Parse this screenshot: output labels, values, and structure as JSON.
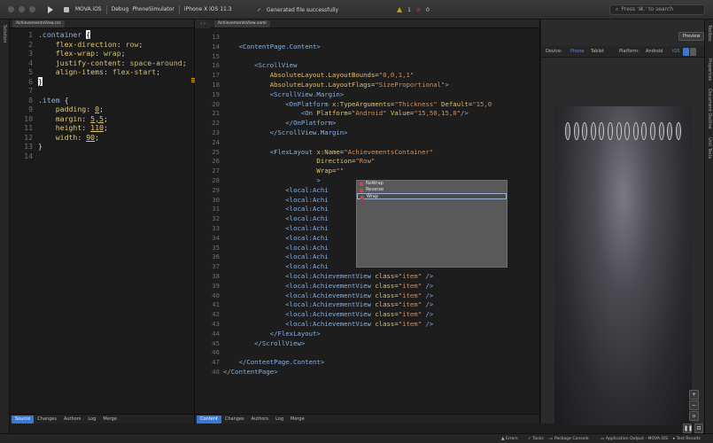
{
  "titlebar": {
    "project": "MOVA.iOS",
    "config": "Debug",
    "target": "PhoneSimulator",
    "device": "iPhone X iOS 11.3",
    "status": "Generated file successfully",
    "warnings": "1",
    "errors": "0",
    "search_placeholder": "Press '⌘.' to search"
  },
  "left_strip": {
    "label": "Solution"
  },
  "css_editor": {
    "tab": "AchievementsView.css",
    "lines": [
      {
        "n": "1",
        "parts": [
          [
            ".container ",
            "sel"
          ],
          [
            "{",
            "cur"
          ]
        ]
      },
      {
        "n": "2",
        "parts": [
          [
            "    flex-direction",
            "prop"
          ],
          [
            ": ",
            "pun"
          ],
          [
            "row",
            "val"
          ],
          [
            ";",
            "pun"
          ]
        ]
      },
      {
        "n": "3",
        "parts": [
          [
            "    flex-wrap",
            "prop"
          ],
          [
            ": ",
            "pun"
          ],
          [
            "wrap",
            "val"
          ],
          [
            ";",
            "pun"
          ]
        ]
      },
      {
        "n": "4",
        "parts": [
          [
            "    justify-content",
            "prop"
          ],
          [
            ": ",
            "pun"
          ],
          [
            "space-around",
            "val"
          ],
          [
            ";",
            "pun"
          ]
        ]
      },
      {
        "n": "5",
        "parts": [
          [
            "    align-items",
            "prop"
          ],
          [
            ": ",
            "pun"
          ],
          [
            "flex-start",
            "val"
          ],
          [
            ";",
            "pun"
          ]
        ]
      },
      {
        "n": "6",
        "parts": [
          [
            "}",
            "cur"
          ]
        ]
      },
      {
        "n": "7",
        "parts": []
      },
      {
        "n": "8",
        "parts": [
          [
            ".item ",
            "sel"
          ],
          [
            "{",
            "pun"
          ]
        ]
      },
      {
        "n": "9",
        "parts": [
          [
            "    padding",
            "prop"
          ],
          [
            ": ",
            "pun"
          ],
          [
            "0",
            "num"
          ],
          [
            ";",
            "pun"
          ]
        ]
      },
      {
        "n": "10",
        "parts": [
          [
            "    margin",
            "prop"
          ],
          [
            ": ",
            "pun"
          ],
          [
            "5,5",
            "num"
          ],
          [
            ";",
            "pun"
          ]
        ]
      },
      {
        "n": "11",
        "parts": [
          [
            "    height",
            "prop"
          ],
          [
            ": ",
            "pun"
          ],
          [
            "110",
            "num"
          ],
          [
            ";",
            "pun"
          ]
        ]
      },
      {
        "n": "12",
        "parts": [
          [
            "    width",
            "prop"
          ],
          [
            ": ",
            "pun"
          ],
          [
            "90",
            "num"
          ],
          [
            ";",
            "pun"
          ]
        ]
      },
      {
        "n": "13",
        "parts": [
          [
            "}",
            "pun"
          ]
        ]
      },
      {
        "n": "14",
        "parts": []
      }
    ],
    "bottom_tabs": [
      "Source",
      "Changes",
      "Authors",
      "Log",
      "Merge"
    ]
  },
  "xaml_editor": {
    "tab": "AchievementsView.xaml",
    "lines": [
      {
        "n": "13",
        "parts": []
      },
      {
        "n": "14",
        "parts": [
          [
            "    <ContentPage.Content>",
            "tag"
          ]
        ]
      },
      {
        "n": "15",
        "parts": []
      },
      {
        "n": "16",
        "parts": [
          [
            "        <ScrollView",
            "tag"
          ]
        ]
      },
      {
        "n": "17",
        "parts": [
          [
            "            AbsoluteLayout.LayoutBounds",
            "attr"
          ],
          [
            "=",
            "txt"
          ],
          [
            "\"0,0,1,1\"",
            "str"
          ]
        ]
      },
      {
        "n": "18",
        "parts": [
          [
            "            AbsoluteLayout.LayoutFlags",
            "attr"
          ],
          [
            "=",
            "txt"
          ],
          [
            "\"SizeProportional\"",
            "str"
          ],
          [
            ">",
            "tag"
          ]
        ]
      },
      {
        "n": "19",
        "parts": [
          [
            "            <ScrollView.Margin>",
            "tag"
          ]
        ]
      },
      {
        "n": "20",
        "parts": [
          [
            "                <OnPlatform ",
            "tag"
          ],
          [
            "x:TypeArguments",
            "attr"
          ],
          [
            "=",
            "txt"
          ],
          [
            "\"Thickness\" ",
            "str"
          ],
          [
            "Default",
            "attr"
          ],
          [
            "=",
            "txt"
          ],
          [
            "\"15,0",
            "str"
          ]
        ]
      },
      {
        "n": "21",
        "parts": [
          [
            "                    <On ",
            "tag"
          ],
          [
            "Platform",
            "attr"
          ],
          [
            "=",
            "txt"
          ],
          [
            "\"Android\" ",
            "str"
          ],
          [
            "Value",
            "attr"
          ],
          [
            "=",
            "txt"
          ],
          [
            "\"15,50,15,0\"",
            "str"
          ],
          [
            "/>",
            "tag"
          ]
        ]
      },
      {
        "n": "22",
        "parts": [
          [
            "                </OnPlatform>",
            "tag"
          ]
        ]
      },
      {
        "n": "23",
        "parts": [
          [
            "            </ScrollView.Margin>",
            "tag"
          ]
        ]
      },
      {
        "n": "24",
        "parts": []
      },
      {
        "n": "25",
        "parts": [
          [
            "            <FlexLayout ",
            "tag"
          ],
          [
            "x:Name",
            "attr"
          ],
          [
            "=",
            "txt"
          ],
          [
            "\"AchievementsContainer\"",
            "str"
          ]
        ]
      },
      {
        "n": "26",
        "parts": [
          [
            "                        Direction",
            "attr"
          ],
          [
            "=",
            "txt"
          ],
          [
            "\"Row\"",
            "str"
          ]
        ]
      },
      {
        "n": "27",
        "parts": [
          [
            "                        Wrap",
            "attr"
          ],
          [
            "=",
            "txt"
          ],
          [
            "\"\"",
            "str"
          ]
        ]
      },
      {
        "n": "28",
        "parts": [
          [
            "                        >",
            "tag"
          ]
        ]
      },
      {
        "n": "29",
        "parts": [
          [
            "                <local:Achi",
            "tag"
          ]
        ]
      },
      {
        "n": "30",
        "parts": [
          [
            "                <local:Achi",
            "tag"
          ]
        ]
      },
      {
        "n": "31",
        "parts": [
          [
            "                <local:Achi",
            "tag"
          ]
        ]
      },
      {
        "n": "32",
        "parts": [
          [
            "                <local:Achi",
            "tag"
          ]
        ]
      },
      {
        "n": "33",
        "parts": [
          [
            "                <local:Achi",
            "tag"
          ]
        ]
      },
      {
        "n": "34",
        "parts": [
          [
            "                <local:Achi",
            "tag"
          ]
        ]
      },
      {
        "n": "35",
        "parts": [
          [
            "                <local:Achi",
            "tag"
          ]
        ]
      },
      {
        "n": "36",
        "parts": [
          [
            "                <local:Achi",
            "tag"
          ]
        ]
      },
      {
        "n": "37",
        "parts": [
          [
            "                <local:Achi",
            "tag"
          ]
        ]
      },
      {
        "n": "38",
        "parts": [
          [
            "                <local:AchievementView ",
            "tag"
          ],
          [
            "class",
            "attr"
          ],
          [
            "=",
            "txt"
          ],
          [
            "\"item\" ",
            "str"
          ],
          [
            "/>",
            "tag"
          ]
        ]
      },
      {
        "n": "39",
        "parts": [
          [
            "                <local:AchievementView ",
            "tag"
          ],
          [
            "class",
            "attr"
          ],
          [
            "=",
            "txt"
          ],
          [
            "\"item\" ",
            "str"
          ],
          [
            "/>",
            "tag"
          ]
        ]
      },
      {
        "n": "40",
        "parts": [
          [
            "                <local:AchievementView ",
            "tag"
          ],
          [
            "class",
            "attr"
          ],
          [
            "=",
            "txt"
          ],
          [
            "\"item\" ",
            "str"
          ],
          [
            "/>",
            "tag"
          ]
        ]
      },
      {
        "n": "41",
        "parts": [
          [
            "                <local:AchievementView ",
            "tag"
          ],
          [
            "class",
            "attr"
          ],
          [
            "=",
            "txt"
          ],
          [
            "\"item\" ",
            "str"
          ],
          [
            "/>",
            "tag"
          ]
        ]
      },
      {
        "n": "42",
        "parts": [
          [
            "                <local:AchievementView ",
            "tag"
          ],
          [
            "class",
            "attr"
          ],
          [
            "=",
            "txt"
          ],
          [
            "\"item\" ",
            "str"
          ],
          [
            "/>",
            "tag"
          ]
        ]
      },
      {
        "n": "43",
        "parts": [
          [
            "                <local:AchievementView ",
            "tag"
          ],
          [
            "class",
            "attr"
          ],
          [
            "=",
            "txt"
          ],
          [
            "\"item\" ",
            "str"
          ],
          [
            "/>",
            "tag"
          ]
        ]
      },
      {
        "n": "44",
        "parts": [
          [
            "            </FlexLayout>",
            "tag"
          ]
        ]
      },
      {
        "n": "45",
        "parts": [
          [
            "        </ScrollView>",
            "tag"
          ]
        ]
      },
      {
        "n": "46",
        "parts": []
      },
      {
        "n": "47",
        "parts": [
          [
            "    </ContentPage.Content>",
            "tag"
          ]
        ]
      },
      {
        "n": "48",
        "parts": [
          [
            "</ContentPage>",
            "tag"
          ]
        ]
      }
    ],
    "autocomplete": [
      "NoWrap",
      "Reverse",
      "Wrap"
    ],
    "autocomplete_selected": 2,
    "bottom_tabs": [
      "Content",
      "Changes",
      "Authors",
      "Log",
      "Merge"
    ]
  },
  "preview": {
    "button": "Preview",
    "device_label": "Device:",
    "devices": [
      "Phone",
      "Tablet"
    ],
    "platform_label": "Platform:",
    "platforms": [
      "Android",
      "iOS"
    ]
  },
  "right_strip": [
    "Toolbox",
    "Properties",
    "Document Outline",
    "Unit Tests"
  ],
  "statusbar": {
    "errors": "Errors",
    "tasks": "Tasks",
    "package_console": "Package Console",
    "app_output": "Application Output - MOVA.iOS",
    "test_results": "Test Results"
  },
  "colors": {
    "accent": "#3b77d6",
    "warning": "#d0a000"
  }
}
